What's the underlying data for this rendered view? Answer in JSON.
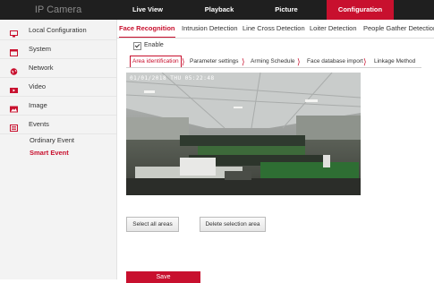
{
  "app": {
    "brand": "IP Camera"
  },
  "topnav": [
    {
      "label": "Live View"
    },
    {
      "label": "Playback"
    },
    {
      "label": "Picture"
    },
    {
      "label": "Configuration",
      "active": true
    }
  ],
  "sidebar": {
    "items": [
      {
        "label": "Local Configuration",
        "icon": "monitor-icon"
      },
      {
        "label": "System",
        "icon": "system-icon"
      },
      {
        "label": "Network",
        "icon": "network-globe-icon"
      },
      {
        "label": "Video",
        "icon": "video-icon"
      },
      {
        "label": "Image",
        "icon": "image-icon"
      },
      {
        "label": "Events",
        "icon": "events-icon"
      }
    ],
    "sub_items": [
      {
        "label": "Ordinary Event"
      },
      {
        "label": "Smart Event",
        "active": true
      }
    ]
  },
  "tabs": [
    {
      "label": "Face Recognition",
      "active": true
    },
    {
      "label": "Intrusion Detection"
    },
    {
      "label": "Line Cross Detection"
    },
    {
      "label": "Loiter Detection"
    },
    {
      "label": "People Gather Detection"
    }
  ],
  "enable": {
    "label": "Enable",
    "checked": true
  },
  "subtabs": [
    {
      "label": "Area identification",
      "active": true
    },
    {
      "label": "Parameter settings"
    },
    {
      "label": "Arming Schedule"
    },
    {
      "label": "Face database import"
    },
    {
      "label": "Linkage Method"
    }
  ],
  "video": {
    "timestamp": "01/01/2018 THU 05:22:48"
  },
  "buttons": {
    "select_all": "Select all areas",
    "delete_selection": "Delete selection area",
    "save": "Save"
  },
  "colors": {
    "accent": "#c8102e",
    "topbar": "#1f1f1f",
    "sidebar": "#f3f3f3"
  }
}
